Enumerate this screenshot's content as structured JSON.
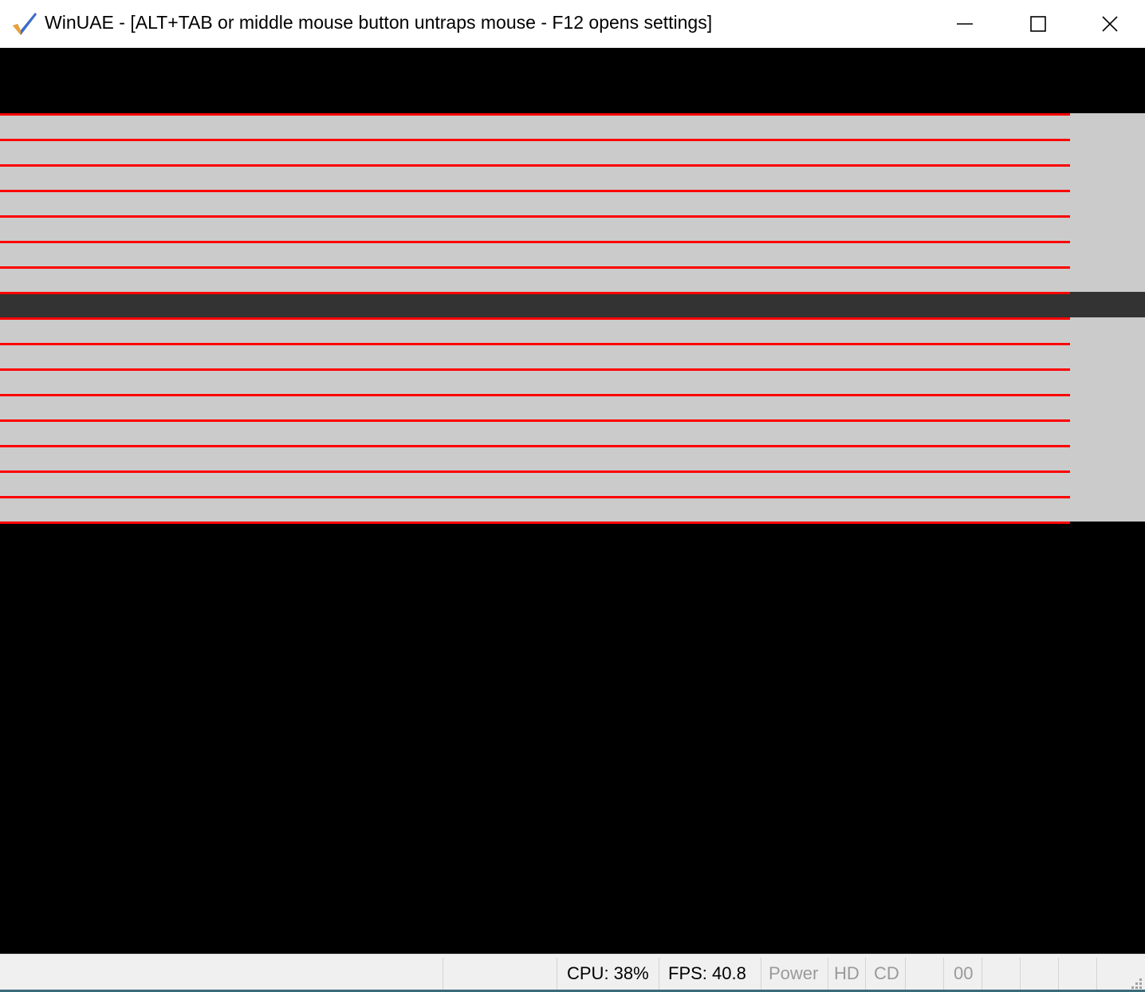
{
  "window": {
    "title": "WinUAE - [ALT+TAB or middle mouse button untraps mouse - F12 opens settings]",
    "icon": "winuae-check-icon"
  },
  "controls": {
    "minimize_icon": "minimize-icon",
    "maximize_icon": "maximize-icon",
    "close_icon": "close-icon"
  },
  "colors": {
    "line": "#ff0000",
    "band": "#cbcbcb",
    "dark_band": "#333333",
    "screen": "#000000"
  },
  "statusbar": {
    "cpu": "CPU: 38%",
    "fps": "FPS: 40.8",
    "power": "Power",
    "hd": "HD",
    "cd": "CD",
    "drive0": "00"
  }
}
